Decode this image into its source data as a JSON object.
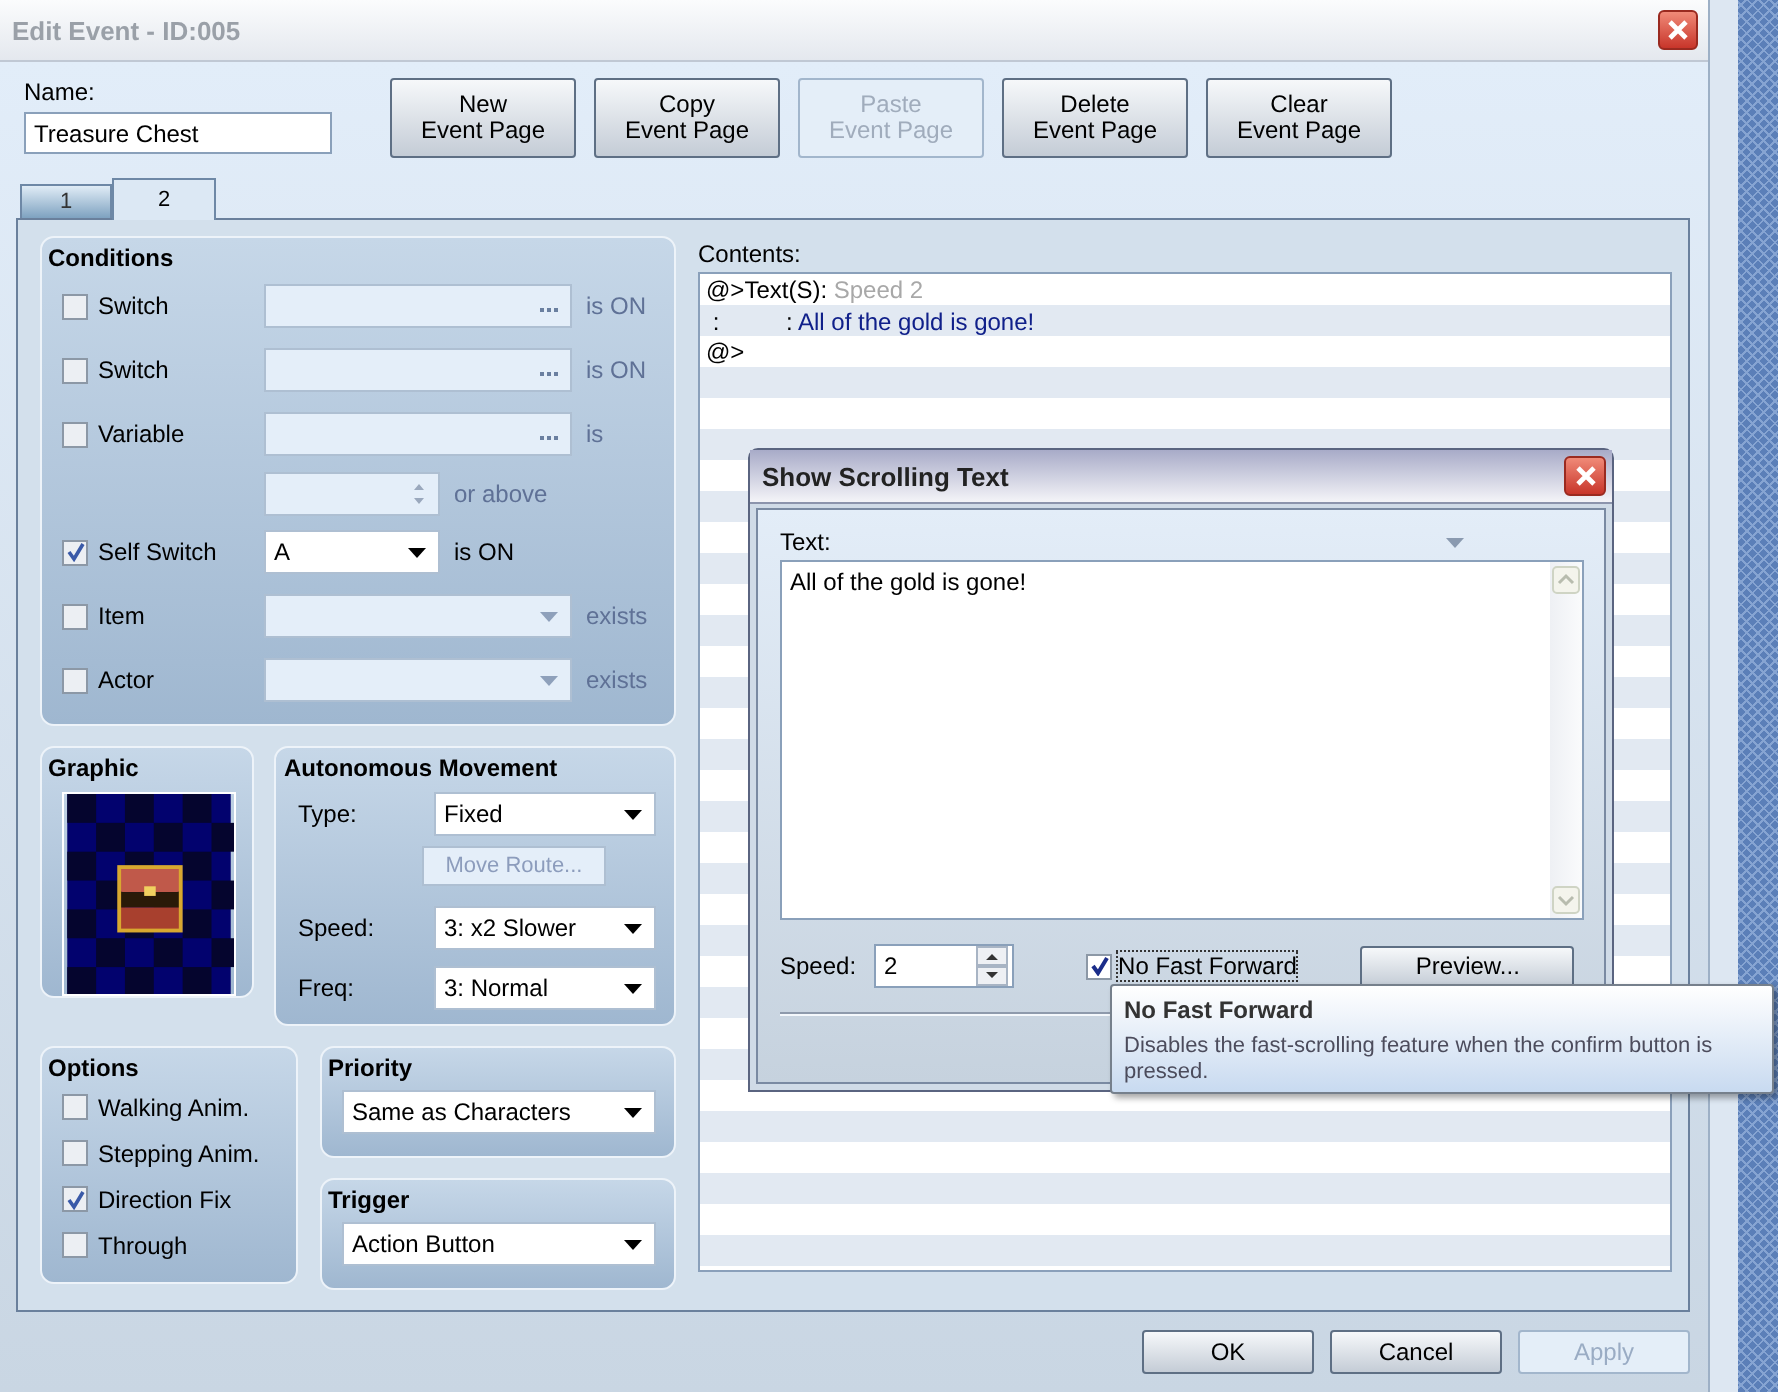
{
  "window": {
    "title": "Edit Event - ID:005"
  },
  "name": {
    "label": "Name:",
    "value": "Treasure Chest"
  },
  "page_buttons": [
    {
      "label": "New\nEvent Page",
      "disabled": false
    },
    {
      "label": "Copy\nEvent Page",
      "disabled": false
    },
    {
      "label": "Paste\nEvent Page",
      "disabled": true
    },
    {
      "label": "Delete\nEvent Page",
      "disabled": false
    },
    {
      "label": "Clear\nEvent Page",
      "disabled": false
    }
  ],
  "tabs": [
    {
      "label": "1",
      "selected": false
    },
    {
      "label": "2",
      "selected": true
    }
  ],
  "conditions": {
    "title": "Conditions",
    "rows": [
      {
        "kind": "picker",
        "label": "Switch",
        "checked": false,
        "suffix": "is ON"
      },
      {
        "kind": "picker",
        "label": "Switch",
        "checked": false,
        "suffix": "is ON"
      },
      {
        "kind": "picker",
        "label": "Variable",
        "checked": false,
        "suffix": "is"
      },
      {
        "kind": "number",
        "checked": false,
        "suffix": "or above"
      },
      {
        "kind": "select",
        "label": "Self Switch",
        "checked": true,
        "value": "A",
        "suffix": "is ON"
      },
      {
        "kind": "select",
        "label": "Item",
        "checked": false,
        "suffix": "exists"
      },
      {
        "kind": "select",
        "label": "Actor",
        "checked": false,
        "suffix": "exists"
      }
    ]
  },
  "graphic": {
    "title": "Graphic",
    "kind": "picture"
  },
  "movement": {
    "title": "Autonomous Movement",
    "type": {
      "label": "Type:",
      "value": "Fixed"
    },
    "route_button": {
      "label": "Move Route...",
      "disabled": true
    },
    "speed": {
      "label": "Speed:",
      "value": "3: x2 Slower"
    },
    "freq": {
      "label": "Freq:",
      "value": "3: Normal"
    }
  },
  "options": {
    "title": "Options",
    "items": [
      {
        "label": "Walking Anim.",
        "checked": false
      },
      {
        "label": "Stepping Anim.",
        "checked": false
      },
      {
        "label": "Direction Fix",
        "checked": true
      },
      {
        "label": "Through",
        "checked": false
      }
    ]
  },
  "priority": {
    "title": "Priority",
    "value": "Same as Characters"
  },
  "trigger": {
    "title": "Trigger",
    "value": "Action Button"
  },
  "contents": {
    "label": "Contents:",
    "lines": [
      {
        "kind": "command",
        "prefix": "@>Text(S): ",
        "detail": "Speed 2"
      },
      {
        "kind": "text",
        "prefix": " :          : ",
        "detail": "All of the gold is gone!"
      },
      {
        "prefix": "@>"
      }
    ]
  },
  "dialog": {
    "title": "Show Scrolling Text",
    "text_label": "Text:",
    "text_value": "All of the gold is gone!",
    "speed_label": "Speed:",
    "speed_value": "2",
    "no_fast_forward": {
      "label": "No Fast Forward",
      "checked": true
    },
    "preview_button": "Preview..."
  },
  "tooltip": {
    "title": "No Fast Forward",
    "body": "Disables the fast-scrolling feature when the confirm button is pressed."
  },
  "footer_buttons": [
    {
      "label": "OK",
      "disabled": false
    },
    {
      "label": "Cancel",
      "disabled": false
    },
    {
      "label": "Apply",
      "disabled": true
    }
  ]
}
